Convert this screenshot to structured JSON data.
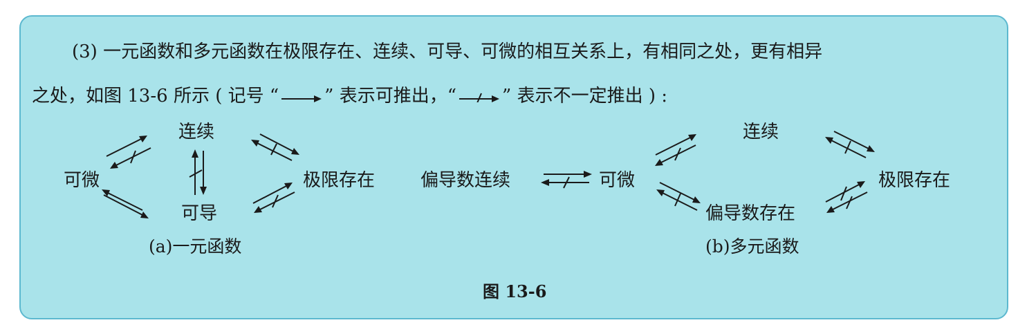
{
  "colors": {
    "box_background": "#a9e3ea",
    "box_border": "#5cb8cf",
    "text": "#1a1a1a"
  },
  "paragraph": {
    "line1": "(3) 一元函数和多元函数在极限存在、连续、可导、可微的相互关系上，有相同之处，更有相异",
    "line2_part1": "之处，如图 13-6 所示 ( 记号 “",
    "line2_part2": "” 表示可推出，“",
    "line2_part3": "” 表示不一定推出 ) :",
    "symbols": [
      "implies-arrow",
      "not-necessarily-implies-arrow"
    ]
  },
  "figure_a": {
    "nodes": {
      "continuous": "连续",
      "differentiable": "可微",
      "derivable": "可导",
      "limit_exists": "极限存在"
    },
    "caption": "(a)一元函数",
    "relations": [
      {
        "from": "可微",
        "to": "连续",
        "implies": true
      },
      {
        "from": "连续",
        "to": "可微",
        "implies": false
      },
      {
        "from": "连续",
        "to": "可导",
        "implies": true
      },
      {
        "from": "可导",
        "to": "连续",
        "implies": false
      },
      {
        "from": "连续",
        "to": "极限存在",
        "implies": true
      },
      {
        "from": "极限存在",
        "to": "连续",
        "implies": false
      },
      {
        "from": "可导",
        "to": "极限存在",
        "implies": true
      },
      {
        "from": "极限存在",
        "to": "可导",
        "implies": false
      },
      {
        "from": "可微",
        "to": "可导",
        "implies": true
      },
      {
        "from": "可导",
        "to": "可微",
        "implies": true
      }
    ]
  },
  "figure_b": {
    "nodes": {
      "partial_continuous": "偏导数连续",
      "differentiable": "可微",
      "continuous": "连续",
      "partial_exists": "偏导数存在",
      "limit_exists": "极限存在"
    },
    "caption": "(b)多元函数",
    "relations": [
      {
        "from": "偏导数连续",
        "to": "可微",
        "implies": true
      },
      {
        "from": "可微",
        "to": "偏导数连续",
        "implies": false
      },
      {
        "from": "可微",
        "to": "连续",
        "implies": true
      },
      {
        "from": "连续",
        "to": "可微",
        "implies": false
      },
      {
        "from": "可微",
        "to": "偏导数存在",
        "implies": true
      },
      {
        "from": "偏导数存在",
        "to": "可微",
        "implies": false
      },
      {
        "from": "连续",
        "to": "极限存在",
        "implies": true
      },
      {
        "from": "极限存在",
        "to": "连续",
        "implies": false
      },
      {
        "from": "偏导数存在",
        "to": "极限存在",
        "implies": false
      },
      {
        "from": "极限存在",
        "to": "偏导数存在",
        "implies": false
      }
    ]
  },
  "figure_title": "图 13-6"
}
